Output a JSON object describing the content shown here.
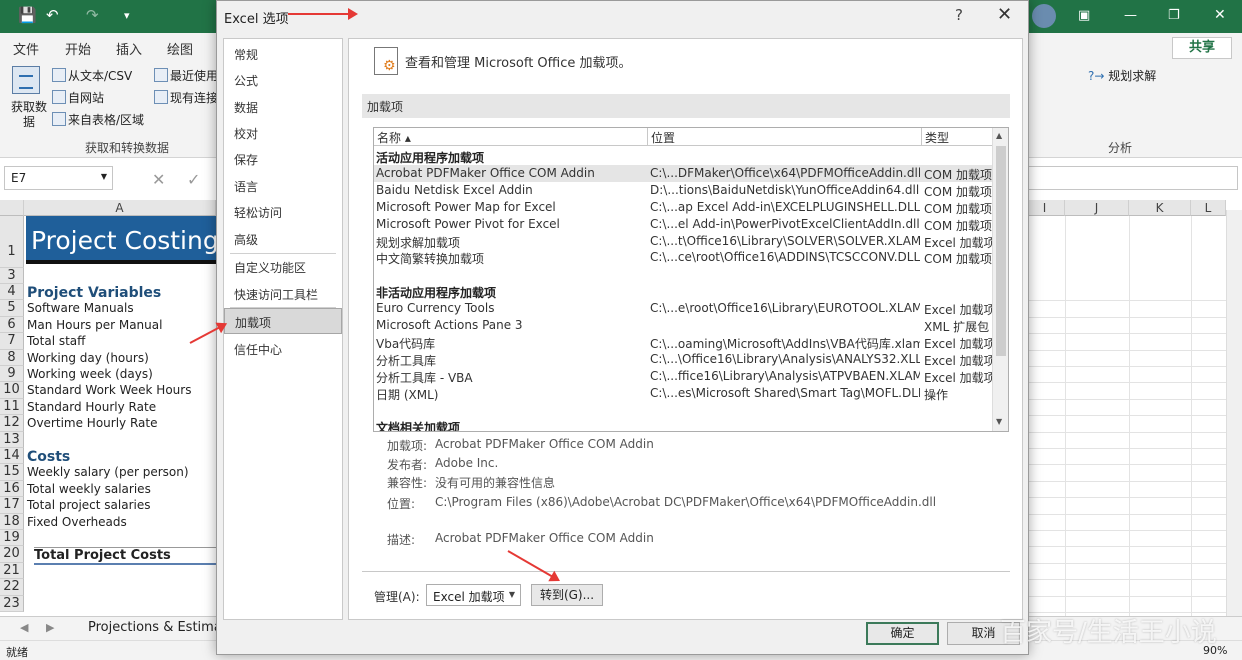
{
  "excel": {
    "ribbon_tabs": [
      "文件",
      "开始",
      "插入",
      "绘图"
    ],
    "share": "共享",
    "get_data": "获取数\n据",
    "from_text": "从文本/CSV",
    "recent": "最近使用",
    "from_web": "自网站",
    "existing": "现有连接",
    "from_table": "来自表格/区域",
    "group_label": "获取和转换数据",
    "solver": "规划求解",
    "analysis": "分析",
    "namebox": "E7",
    "col_a": "A",
    "cols_right": [
      "I",
      "J",
      "K",
      "L"
    ],
    "banner": "Project Costing C",
    "rows": [
      {
        "n": "1",
        "t": ""
      },
      {
        "n": "3",
        "t": ""
      },
      {
        "n": "4",
        "t": "Project Variables",
        "k": "head"
      },
      {
        "n": "5",
        "t": "Software Manuals"
      },
      {
        "n": "6",
        "t": "Man Hours per Manual"
      },
      {
        "n": "7",
        "t": "Total staff"
      },
      {
        "n": "8",
        "t": "Working day (hours)"
      },
      {
        "n": "9",
        "t": "Working week (days)"
      },
      {
        "n": "10",
        "t": "Standard Work Week Hours"
      },
      {
        "n": "11",
        "t": "Standard Hourly Rate"
      },
      {
        "n": "12",
        "t": "Overtime Hourly Rate"
      },
      {
        "n": "13",
        "t": ""
      },
      {
        "n": "14",
        "t": "Costs",
        "k": "head"
      },
      {
        "n": "15",
        "t": "Weekly salary (per person)"
      },
      {
        "n": "16",
        "t": "Total weekly salaries"
      },
      {
        "n": "17",
        "t": "Total project salaries"
      },
      {
        "n": "18",
        "t": "Fixed Overheads"
      },
      {
        "n": "19",
        "t": ""
      },
      {
        "n": "20",
        "t": "Total Project Costs",
        "k": "total"
      },
      {
        "n": "21",
        "t": ""
      },
      {
        "n": "22",
        "t": ""
      },
      {
        "n": "23",
        "t": ""
      }
    ],
    "sheet_tab": "Projections & Estimat",
    "status": "就绪",
    "zoom": "90%"
  },
  "dialog": {
    "title": "Excel 选项",
    "help": "?",
    "close": "✕",
    "nav": [
      "常规",
      "公式",
      "数据",
      "校对",
      "保存",
      "语言",
      "轻松访问",
      "高级",
      "自定义功能区",
      "快速访问工具栏",
      "加载项",
      "信任中心"
    ],
    "selected_nav": "加载项",
    "header": "查看和管理 Microsoft Office 加载项。",
    "section": "加载项",
    "columns": [
      "名称 ▴",
      "位置",
      "类型"
    ],
    "groups": [
      {
        "title": "活动应用程序加载项",
        "items": [
          {
            "name": "Acrobat PDFMaker Office COM Addin",
            "loc": "C:\\...DFMaker\\Office\\x64\\PDFMOfficeAddin.dll",
            "type": "COM 加载项"
          },
          {
            "name": "Baidu Netdisk Excel Addin",
            "loc": "D:\\...tions\\BaiduNetdisk\\YunOfficeAddin64.dll",
            "type": "COM 加载项"
          },
          {
            "name": "Microsoft Power Map for Excel",
            "loc": "C:\\...ap Excel Add-in\\EXCELPLUGINSHELL.DLL",
            "type": "COM 加载项"
          },
          {
            "name": "Microsoft Power Pivot for Excel",
            "loc": "C:\\...el Add-in\\PowerPivotExcelClientAddIn.dll",
            "type": "COM 加载项"
          },
          {
            "name": "规划求解加载项",
            "loc": "C:\\...t\\Office16\\Library\\SOLVER\\SOLVER.XLAM",
            "type": "Excel 加载项"
          },
          {
            "name": "中文简繁转换加载项",
            "loc": "C:\\...ce\\root\\Office16\\ADDINS\\TCSCCONV.DLL",
            "type": "COM 加载项"
          }
        ]
      },
      {
        "title": "非活动应用程序加载项",
        "items": [
          {
            "name": "Euro Currency Tools",
            "loc": "C:\\...e\\root\\Office16\\Library\\EUROTOOL.XLAM",
            "type": "Excel 加载项"
          },
          {
            "name": "Microsoft Actions Pane 3",
            "loc": "",
            "type": "XML 扩展包"
          },
          {
            "name": "Vba代码库",
            "loc": "C:\\...oaming\\Microsoft\\AddIns\\VBA代码库.xlam",
            "type": "Excel 加载项"
          },
          {
            "name": "分析工具库",
            "loc": "C:\\...\\Office16\\Library\\Analysis\\ANALYS32.XLL",
            "type": "Excel 加载项"
          },
          {
            "name": "分析工具库 - VBA",
            "loc": "C:\\...ffice16\\Library\\Analysis\\ATPVBAEN.XLAM",
            "type": "Excel 加载项"
          },
          {
            "name": "日期 (XML)",
            "loc": "C:\\...es\\Microsoft Shared\\Smart Tag\\MOFL.DLL",
            "type": "操作"
          }
        ]
      },
      {
        "title": "文档相关加载项",
        "items": []
      }
    ],
    "details": {
      "addin_label": "加载项:",
      "addin": "Acrobat PDFMaker Office COM Addin",
      "publisher_label": "发布者:",
      "publisher": "Adobe Inc.",
      "compat_label": "兼容性:",
      "compat": "没有可用的兼容性信息",
      "location_label": "位置:",
      "location": "C:\\Program Files (x86)\\Adobe\\Acrobat DC\\PDFMaker\\Office\\x64\\PDFMOfficeAddin.dll",
      "desc_label": "描述:",
      "desc": "Acrobat PDFMaker Office COM Addin"
    },
    "manage_label": "管理(A):",
    "manage_value": "Excel 加载项",
    "go_button": "转到(G)...",
    "ok": "确定",
    "cancel": "取消"
  },
  "watermark": "百家号/生活王小说",
  "colors": {
    "excel_green": "#217346",
    "accent_red": "#e53935"
  }
}
